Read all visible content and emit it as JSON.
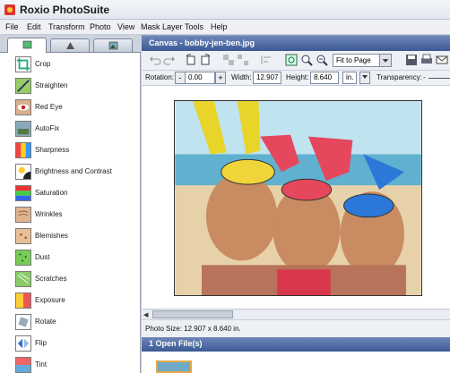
{
  "window": {
    "title": "Roxio PhotoSuite"
  },
  "menu": [
    "File",
    "Edit",
    "Transform",
    "Photo",
    "View",
    "Mask Layer",
    "Tools",
    "Help"
  ],
  "left_panel": {
    "tabs": [
      {
        "icon": "tools-tab-icon"
      },
      {
        "icon": "objects-tab-icon"
      },
      {
        "icon": "image-tab-icon"
      }
    ],
    "tools": [
      {
        "label": "Crop",
        "icon": "crop-icon"
      },
      {
        "label": "Straighten",
        "icon": "straighten-icon"
      },
      {
        "label": "Red Eye",
        "icon": "red-eye-icon"
      },
      {
        "label": "AutoFix",
        "icon": "autofix-icon"
      },
      {
        "label": "Sharpness",
        "icon": "sharpness-icon"
      },
      {
        "label": "Brightness and Contrast",
        "icon": "brightness-icon"
      },
      {
        "label": "Saturation",
        "icon": "saturation-icon"
      },
      {
        "label": "Wrinkles",
        "icon": "wrinkles-icon"
      },
      {
        "label": "Blemishes",
        "icon": "blemishes-icon"
      },
      {
        "label": "Dust",
        "icon": "dust-icon"
      },
      {
        "label": "Scratches",
        "icon": "scratches-icon"
      },
      {
        "label": "Exposure",
        "icon": "exposure-icon"
      },
      {
        "label": "Rotate",
        "icon": "rotate-icon"
      },
      {
        "label": "Flip",
        "icon": "flip-icon"
      },
      {
        "label": "Tint",
        "icon": "tint-icon"
      }
    ]
  },
  "canvas": {
    "title": "Canvas - bobby-jen-ben.jpg",
    "zoom": "Fit to Page",
    "rotation_label": "Rotation:",
    "rotation_value": "0.00",
    "width_label": "Width:",
    "width_value": "12.907",
    "height_label": "Height:",
    "height_value": "8.640",
    "unit": "in.",
    "transparency_label": "Transparency:",
    "minus": "-",
    "plus": "+",
    "status": "Photo Size: 12.907 x 8.640 in."
  },
  "open_files": {
    "header": "1 Open File(s)"
  },
  "colors": {
    "title_blue": "#3b5994",
    "accent_orange": "#e4a84a"
  }
}
